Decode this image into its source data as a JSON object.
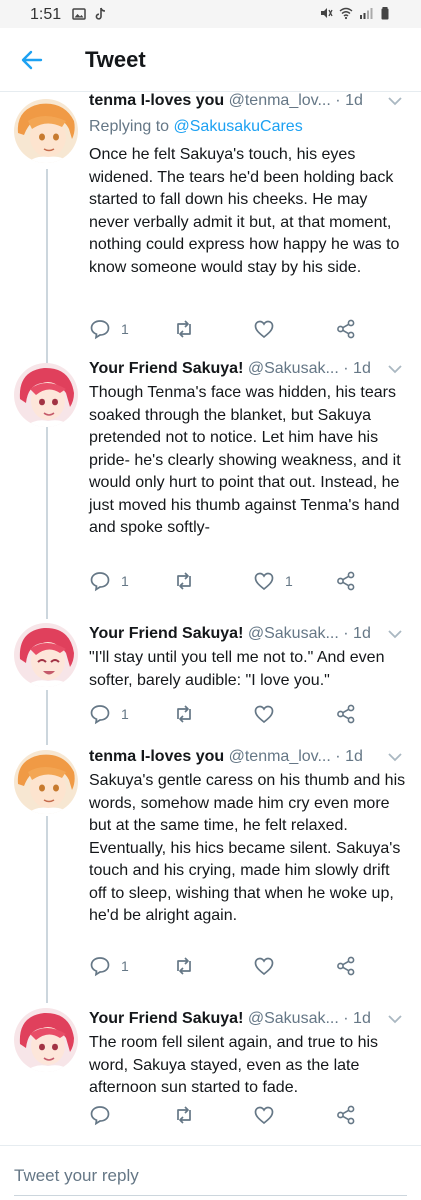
{
  "status_bar": {
    "time": "1:51",
    "left_icons": [
      "image-icon",
      "tiktok-icon"
    ],
    "right_icons": [
      "mute-icon",
      "wifi-icon",
      "signal-icon",
      "battery-icon"
    ]
  },
  "header": {
    "back_icon": "back-arrow-icon",
    "title": "Tweet"
  },
  "colors": {
    "accent": "#1da1f2",
    "secondary_text": "#657786",
    "thread_line": "#ccd6dd",
    "divider": "#e6ecf0"
  },
  "tweets": [
    {
      "name": "tenma I-loves you",
      "handle": "@tenma_lov...",
      "time": "1d",
      "replying_prefix": "Replying to",
      "replying_to": "@SakusakuCares",
      "text": "Once he felt Sakuya's touch, his eyes widened. The tears he'd been holding back started to fall down his cheeks. He may never verbally admit it but, at that moment, nothing could express how happy he was to know someone would stay by his side.",
      "reply_count": "1",
      "retweet_count": "",
      "like_count": ""
    },
    {
      "name": "Your Friend Sakuya!",
      "handle": "@Sakusak...",
      "time": "1d",
      "text": "Though Tenma's face was hidden, his tears soaked through the blanket, but Sakuya pretended not to notice. Let him have his pride- he's clearly showing weakness, and it would only hurt to point that out. Instead, he just moved his thumb against Tenma's hand and spoke softly-",
      "reply_count": "1",
      "retweet_count": "",
      "like_count": "1"
    },
    {
      "name": "Your Friend Sakuya!",
      "handle": "@Sakusak...",
      "time": "1d",
      "text": "\"I'll stay until you tell me not to.\" And even softer, barely audible: \"I love you.\"",
      "reply_count": "1",
      "retweet_count": "",
      "like_count": ""
    },
    {
      "name": "tenma I-loves you",
      "handle": "@tenma_lov...",
      "time": "1d",
      "text": "Sakuya's gentle caress on his thumb and his words, somehow made him cry even more but at the same time, he felt relaxed. Eventually, his hics became silent. Sakuya's touch and his crying, made him slowly drift off to sleep, wishing that when he woke up, he'd be alright again.",
      "reply_count": "1",
      "retweet_count": "",
      "like_count": ""
    },
    {
      "name": "Your Friend Sakuya!",
      "handle": "@Sakusak...",
      "time": "1d",
      "text": "The room fell silent again, and true to his word, Sakuya stayed, even as the late afternoon sun started to fade.",
      "reply_count": "",
      "retweet_count": "",
      "like_count": ""
    }
  ],
  "reply_bar": {
    "placeholder": "Tweet your reply"
  }
}
